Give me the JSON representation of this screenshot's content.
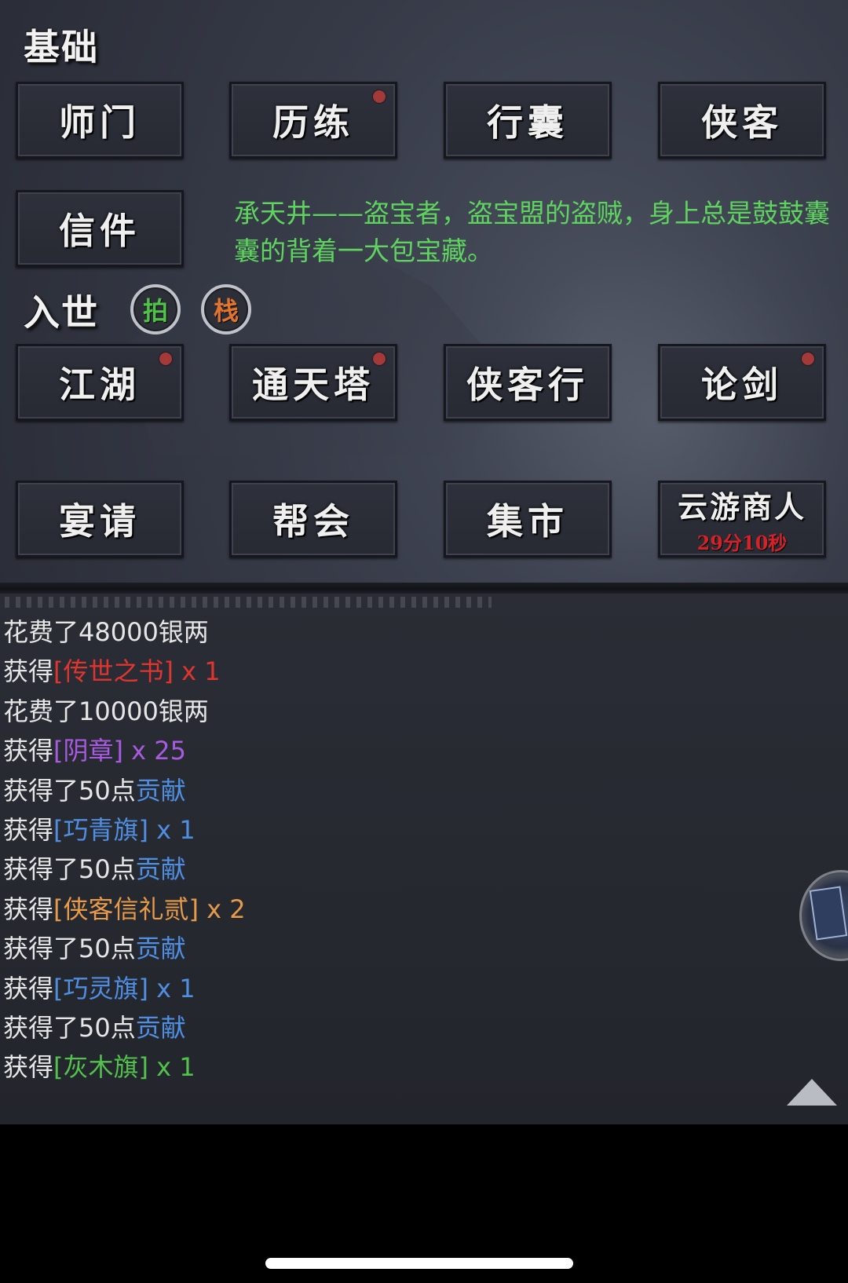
{
  "sections": {
    "basic_label": "基础",
    "world_label": "入世"
  },
  "basic_buttons": [
    {
      "label": "师门",
      "dot": false
    },
    {
      "label": "历练",
      "dot": true
    },
    {
      "label": "行囊",
      "dot": false
    },
    {
      "label": "侠客",
      "dot": false
    },
    {
      "label": "信件",
      "dot": false
    }
  ],
  "description": "承天井——盗宝者，盗宝盟的盗贼，身上总是鼓鼓囊囊的背着一大包宝藏。",
  "badges": [
    {
      "label": "拍",
      "color": "#4fc24a"
    },
    {
      "label": "栈",
      "color": "#e2742b"
    }
  ],
  "world_buttons": [
    {
      "label": "江湖",
      "dot": true
    },
    {
      "label": "通天塔",
      "dot": true
    },
    {
      "label": "侠客行",
      "dot": false
    },
    {
      "label": "论剑",
      "dot": true
    },
    {
      "label": "宴请",
      "dot": false
    },
    {
      "label": "帮会",
      "dot": false
    },
    {
      "label": "集市",
      "dot": false
    },
    {
      "label": "云游商人",
      "timer": "29分10秒",
      "dot": false
    }
  ],
  "log": [
    {
      "prefix": "花费了48000银两",
      "item": "",
      "suffix": "",
      "color": ""
    },
    {
      "prefix": "获得",
      "item": "[传世之书]",
      "suffix": " x 1",
      "color": "red"
    },
    {
      "prefix": "花费了10000银两",
      "item": "",
      "suffix": "",
      "color": ""
    },
    {
      "prefix": "获得",
      "item": "[阴章]",
      "suffix": " x 25",
      "color": "purple"
    },
    {
      "prefix": "获得了50点",
      "item": "贡献",
      "suffix": "",
      "color": "blue"
    },
    {
      "prefix": "获得",
      "item": "[巧青旗]",
      "suffix": " x 1",
      "color": "blue"
    },
    {
      "prefix": "获得了50点",
      "item": "贡献",
      "suffix": "",
      "color": "blue"
    },
    {
      "prefix": "获得",
      "item": "[侠客信礼贰]",
      "suffix": " x 2",
      "color": "orange"
    },
    {
      "prefix": "获得了50点",
      "item": "贡献",
      "suffix": "",
      "color": "blue"
    },
    {
      "prefix": "获得",
      "item": "[巧灵旗]",
      "suffix": " x 1",
      "color": "blue"
    },
    {
      "prefix": "获得了50点",
      "item": "贡献",
      "suffix": "",
      "color": "blue"
    },
    {
      "prefix": "获得",
      "item": "[灰木旗]",
      "suffix": " x 1",
      "color": "green"
    }
  ]
}
